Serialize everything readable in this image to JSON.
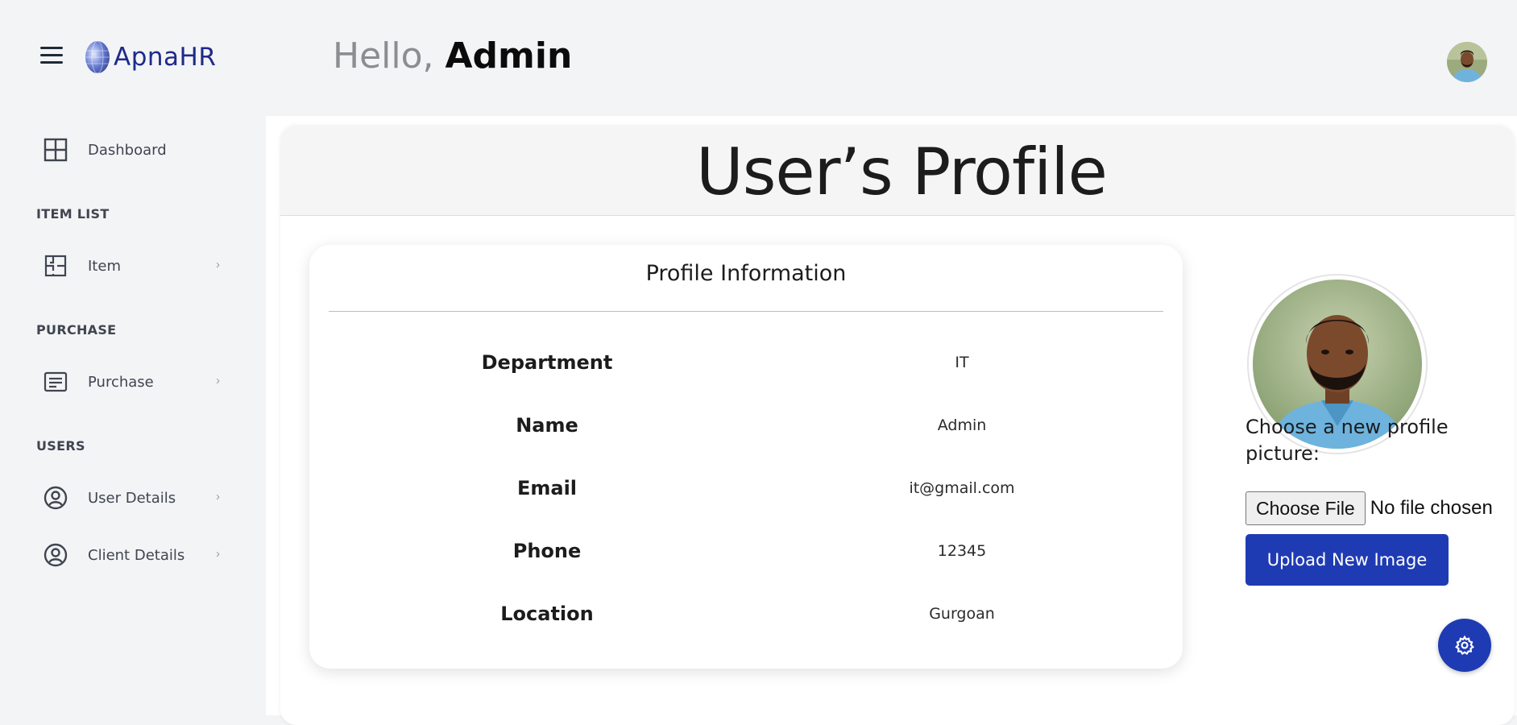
{
  "app": {
    "brand": "ApnaHR",
    "greeting_hello": "Hello, ",
    "greeting_name": "Admin"
  },
  "sidebar": {
    "dashboard": "Dashboard",
    "sections": [
      {
        "title": "ITEM LIST",
        "items": [
          {
            "label": "Item",
            "icon": "floorplan-icon"
          }
        ]
      },
      {
        "title": "PURCHASE",
        "items": [
          {
            "label": "Purchase",
            "icon": "list-card-icon"
          }
        ]
      },
      {
        "title": "USERS",
        "items": [
          {
            "label": "User Details",
            "icon": "user-circle-icon"
          },
          {
            "label": "Client Details",
            "icon": "user-circle-icon"
          }
        ]
      }
    ],
    "chevron": "›"
  },
  "main": {
    "page_title": "User’s Profile",
    "info_title": "Profile Information",
    "fields": [
      {
        "label": "Department",
        "value": "IT"
      },
      {
        "label": "Name",
        "value": "Admin"
      },
      {
        "label": "Email",
        "value": "it@gmail.com"
      },
      {
        "label": "Phone",
        "value": "12345"
      },
      {
        "label": "Location",
        "value": "Gurgoan"
      }
    ],
    "choose_label": "Choose a new profile picture:",
    "choose_file": "Choose File",
    "no_file": "No file chosen",
    "upload": "Upload New Image"
  },
  "colors": {
    "accent": "#1f3bb3",
    "brand_text": "#1e2a8a",
    "background": "#f3f4f6"
  }
}
